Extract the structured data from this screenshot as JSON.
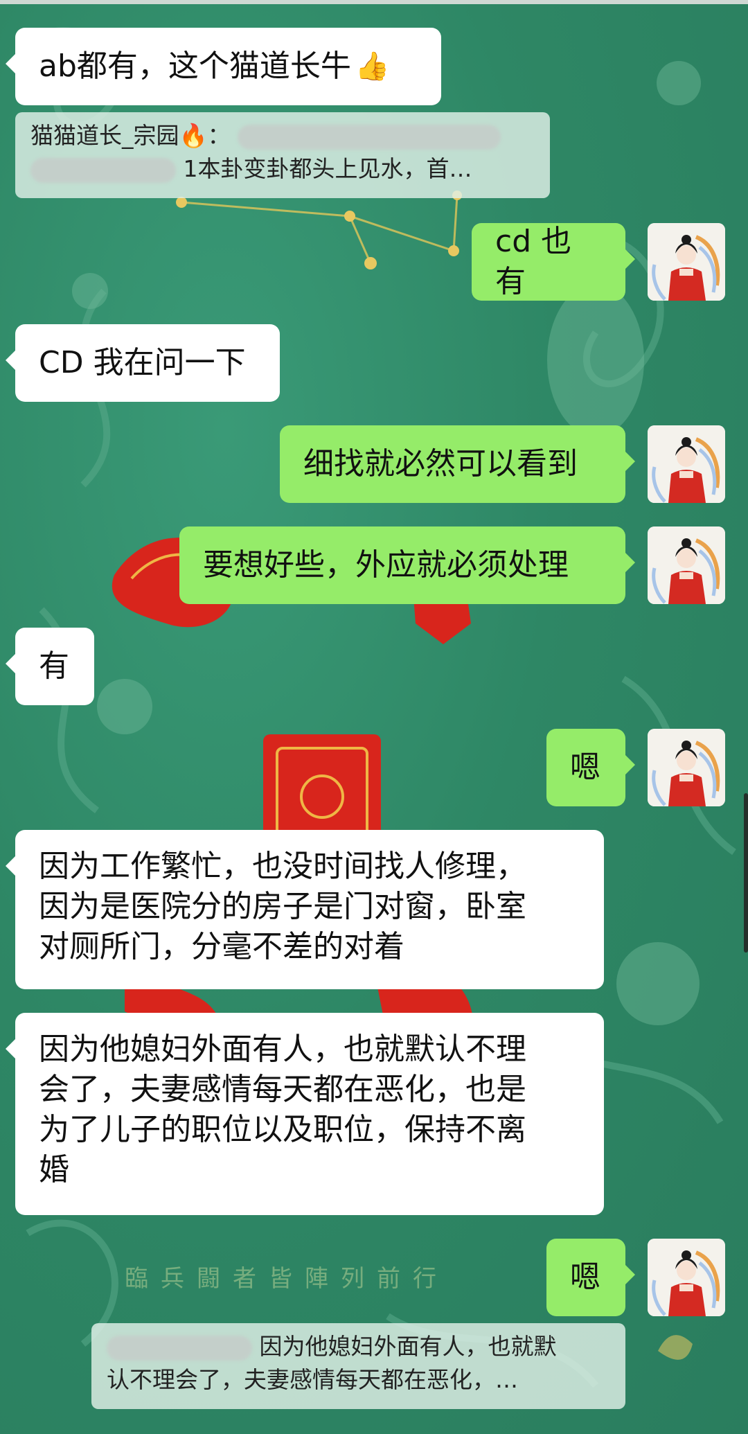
{
  "messages": [
    {
      "side": "in",
      "text": "ab都有，这个猫道长牛",
      "emoji": "👍"
    },
    {
      "quote": true,
      "sender": "猫猫道长_宗园",
      "sender_emoji": "🔥",
      "colon": "：",
      "line2": "1本卦变卦都头上见水，首…"
    },
    {
      "side": "out",
      "text": "cd 也有"
    },
    {
      "side": "in",
      "text": "CD 我在问一下"
    },
    {
      "side": "out",
      "text": "细找就必然可以看到"
    },
    {
      "side": "out",
      "text": "要想好些，外应就必须处理"
    },
    {
      "side": "in",
      "text": "有"
    },
    {
      "side": "out",
      "text": "嗯"
    },
    {
      "side": "in",
      "lines": [
        "因为工作繁忙，也没时间找人修理，",
        "因为是医院分的房子是门对窗，卧室",
        "对厕所门，分毫不差的对着"
      ]
    },
    {
      "side": "in",
      "lines": [
        "因为他媳妇外面有人，也就默认不理",
        "会了，夫妻感情每天都在恶化，也是",
        "为了儿子的职位以及职位，保持不离",
        "婚"
      ]
    },
    {
      "side": "out",
      "text": "嗯"
    },
    {
      "quote": true,
      "line1": "因为他媳妇外面有人，也就默",
      "line2": "认不理会了，夫妻感情每天都在恶化，…"
    }
  ],
  "background": {
    "mantra": "臨兵闘者皆陣列前行",
    "colors": {
      "base": "#2f8a68",
      "pattern": "#5aa98a",
      "red": "#d8251c",
      "gold": "#c9a44a"
    }
  },
  "avatar": {
    "icon": "avatar-woman-red-robe"
  }
}
